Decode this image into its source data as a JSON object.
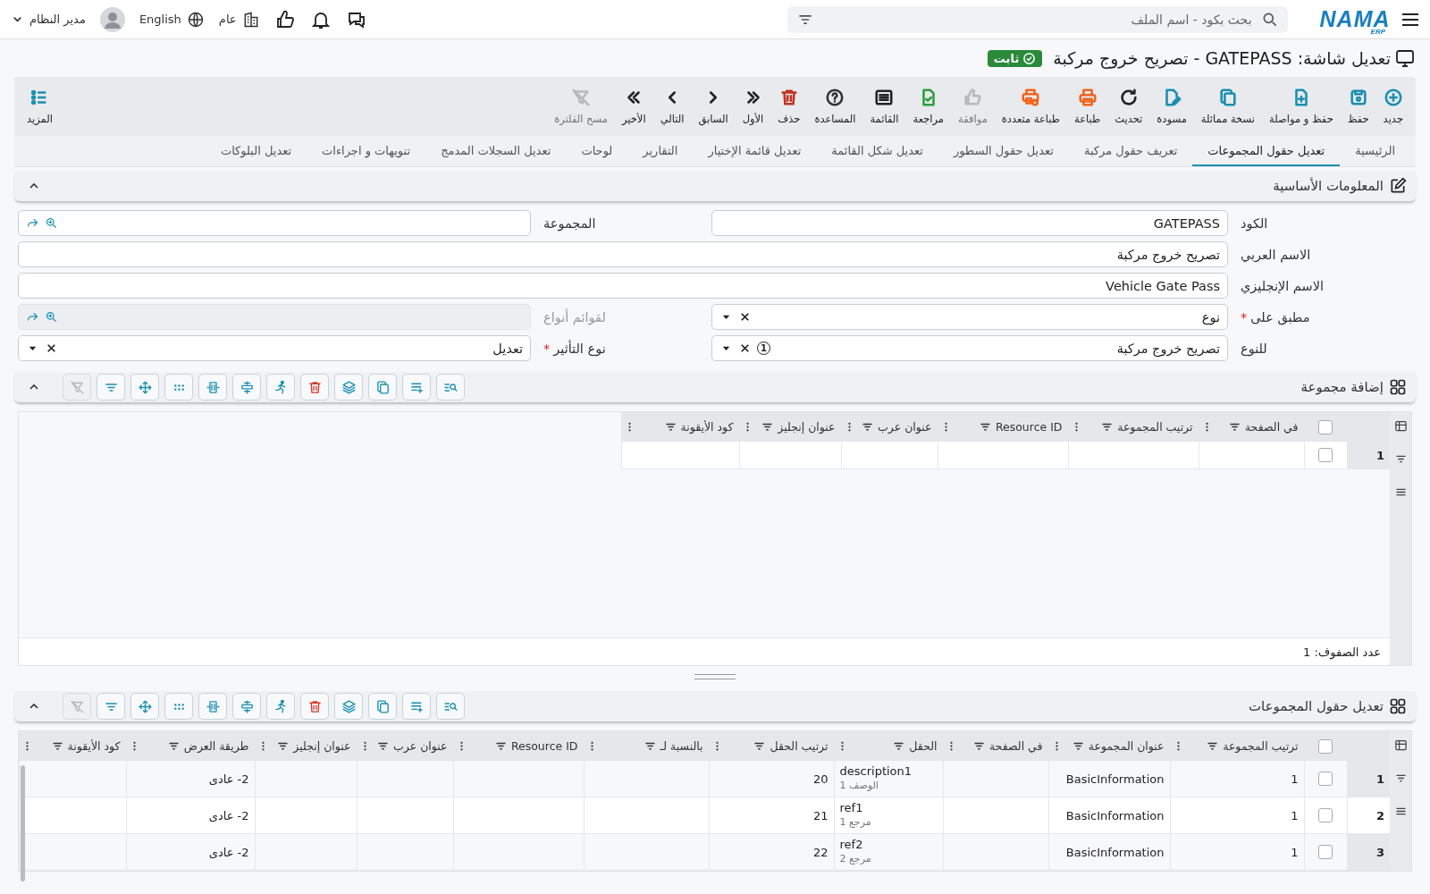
{
  "topbar": {
    "logo": {
      "name": "NAMA",
      "sub": "ERP"
    },
    "search": {
      "placeholder": "بحث بكود - اسم الملف"
    },
    "company": "عام",
    "language": "English",
    "user": "مدير النظام"
  },
  "title": {
    "text": "تعديل شاشة: GATEPASS - تصريح خروج مركبة",
    "badge": "ثابت"
  },
  "toolbar": [
    {
      "label": "جديد",
      "kind": "plus-circle",
      "color": "#1a8fb0",
      "disabled": false
    },
    {
      "label": "حفظ",
      "kind": "save",
      "color": "#1a8fb0",
      "disabled": false
    },
    {
      "label": "حفظ و مواصلة",
      "kind": "file-plus",
      "color": "#1a8fb0",
      "disabled": false
    },
    {
      "label": "نسخة مماثلة",
      "kind": "copy",
      "color": "#1a8fb0",
      "disabled": false
    },
    {
      "label": "مسودة",
      "kind": "pencil",
      "color": "#1a8fb0",
      "disabled": false
    },
    {
      "label": "تحديث",
      "kind": "refresh",
      "color": "#222222",
      "disabled": false
    },
    {
      "label": "طباعة",
      "kind": "printer",
      "color": "#f0641e",
      "disabled": false
    },
    {
      "label": "طباعة متعددة",
      "kind": "printers",
      "color": "#f0641e",
      "disabled": false
    },
    {
      "label": "موافقة",
      "kind": "thumb",
      "color": "#b5b8bd",
      "disabled": true
    },
    {
      "label": "مراجعة",
      "kind": "file-check",
      "color": "#2e9e3e",
      "disabled": false
    },
    {
      "label": "القائمة",
      "kind": "list",
      "color": "#222222",
      "disabled": false
    },
    {
      "label": "المساعدة",
      "kind": "help",
      "color": "#333333",
      "disabled": false
    },
    {
      "label": "حذف",
      "kind": "trash",
      "color": "#c0321e",
      "disabled": false
    },
    {
      "label": "الأول",
      "kind": "first",
      "color": "#222222",
      "disabled": false
    },
    {
      "label": "السابق",
      "kind": "prev",
      "color": "#222222",
      "disabled": false
    },
    {
      "label": "التالي",
      "kind": "next",
      "color": "#222222",
      "disabled": false
    },
    {
      "label": "الأخير",
      "kind": "last",
      "color": "#222222",
      "disabled": false
    },
    {
      "label": "مسح الفلترة",
      "kind": "filter-off",
      "color": "#b5b8bd",
      "disabled": true
    }
  ],
  "more": {
    "label": "المزيد"
  },
  "tabs": [
    {
      "label": "الرئيسية",
      "selected": false
    },
    {
      "label": "تعديل حقول المجموعات",
      "selected": true
    },
    {
      "label": "تعريف حقول مركبة",
      "selected": false
    },
    {
      "label": "تعديل حقول السطور",
      "selected": false
    },
    {
      "label": "تعديل شكل القائمة",
      "selected": false
    },
    {
      "label": "تعديل قائمة الإختيار",
      "selected": false
    },
    {
      "label": "التقارير",
      "selected": false
    },
    {
      "label": "لوحات",
      "selected": false
    },
    {
      "label": "تعديل السجلات المدمج",
      "selected": false
    },
    {
      "label": "تنويهات و اجراءات",
      "selected": false
    },
    {
      "label": "تعديل البلوكات",
      "selected": false
    }
  ],
  "basic_info": {
    "title": "المعلومات الأساسية",
    "fields": [
      {
        "label": "الكود",
        "kind": "text",
        "value": "GATEPASS",
        "span": false,
        "disabled": false
      },
      {
        "label": "المجموعة",
        "kind": "lookup",
        "span": false,
        "disabled": false
      },
      {
        "label": "الاسم العربي",
        "kind": "text",
        "value": "تصريح خروج مركبة",
        "span": true,
        "disabled": false
      },
      {
        "label": "الاسم الإنجليزي",
        "kind": "text",
        "value": "Vehicle Gate Pass",
        "span": true,
        "disabled": false
      },
      {
        "label": "مطبق على",
        "required_mark": "*",
        "kind": "select",
        "value": "نوع",
        "span": false,
        "disabled": false
      },
      {
        "label": "لقوائم أنواع",
        "kind": "lookup",
        "span": false,
        "disabled": true
      },
      {
        "label": "للنوع",
        "kind": "select",
        "value": "تصريح خروج مركبة",
        "count": "1",
        "span": false,
        "disabled": false
      },
      {
        "label": "نوع التأثير",
        "required_mark": "*",
        "kind": "select",
        "value": "تعديل",
        "span": false,
        "disabled": false
      }
    ]
  },
  "grid_tools": [
    {
      "kind": "search-list",
      "disabled": false
    },
    {
      "kind": "list-add",
      "disabled": false
    },
    {
      "kind": "copy",
      "disabled": false
    },
    {
      "kind": "layers",
      "disabled": false
    },
    {
      "kind": "trash",
      "disabled": false
    },
    {
      "kind": "run",
      "disabled": false
    },
    {
      "kind": "rows",
      "disabled": false
    },
    {
      "kind": "columns",
      "disabled": false
    },
    {
      "kind": "dots",
      "disabled": false
    },
    {
      "kind": "move",
      "disabled": false
    },
    {
      "kind": "filter",
      "disabled": false
    },
    {
      "kind": "filter-off",
      "disabled": true
    }
  ],
  "groups": {
    "title": "إضافة مجموعة",
    "columns": [
      "في الصفحة",
      "ترتيب المجموعة",
      "Resource ID",
      "عنوان عرب",
      "عنوان إنجليز",
      "كود الأيقونة"
    ],
    "all_checked": false,
    "rows": [
      {
        "number": "1",
        "checked": false
      }
    ],
    "footer": "عدد الصفوف: 1"
  },
  "group_fields": {
    "title": "تعديل حقول المجموعات",
    "columns": [
      "ترتيب المجموعة",
      "عنوان المجموعة",
      "في الصفحة",
      "الحقل",
      "ترتيب الحقل",
      "بالنسبة لـ",
      "Resource ID",
      "عنوان عرب",
      "عنوان إنجليز",
      "طريقة العرض",
      "كود الأيقونة"
    ],
    "all_checked": false,
    "rows": [
      {
        "number": "1",
        "checked": false,
        "group_order": "1",
        "group_title": "BasicInformation",
        "field": {
          "name": "description1",
          "caption": "الوصف 1"
        },
        "field_order": "20",
        "display_mode": "2- عادى"
      },
      {
        "number": "2",
        "checked": false,
        "group_order": "1",
        "group_title": "BasicInformation",
        "field": {
          "name": "ref1",
          "caption": "مرجع 1"
        },
        "field_order": "21",
        "display_mode": "2- عادى"
      },
      {
        "number": "3",
        "checked": false,
        "group_order": "1",
        "group_title": "BasicInformation",
        "field": {
          "name": "ref2",
          "caption": "مرجع 2"
        },
        "field_order": "22",
        "display_mode": "2- عادى"
      }
    ]
  }
}
